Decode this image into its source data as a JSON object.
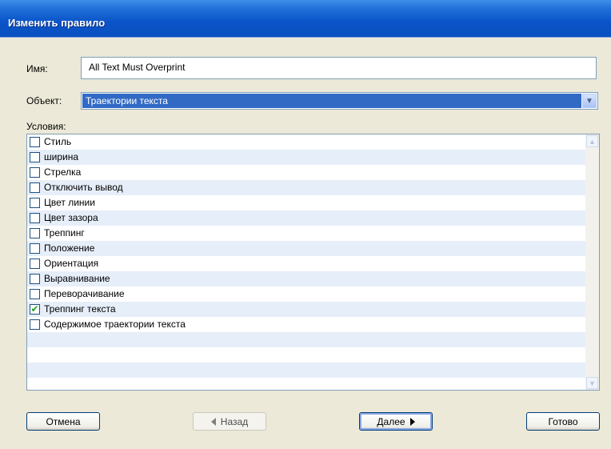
{
  "window": {
    "title": "Изменить правило"
  },
  "form": {
    "name_label": "Имя:",
    "name_value": "All Text Must Overprint",
    "object_label": "Объект:",
    "object_value": "Траектории текста",
    "conditions_label": "Условия:"
  },
  "conditions": [
    {
      "label": "Стиль",
      "checked": false
    },
    {
      "label": "ширина",
      "checked": false
    },
    {
      "label": "Стрелка",
      "checked": false
    },
    {
      "label": "Отключить вывод",
      "checked": false
    },
    {
      "label": "Цвет линии",
      "checked": false
    },
    {
      "label": "Цвет зазора",
      "checked": false
    },
    {
      "label": "Треппинг",
      "checked": false
    },
    {
      "label": "Положение",
      "checked": false
    },
    {
      "label": "Ориентация",
      "checked": false
    },
    {
      "label": "Выравнивание",
      "checked": false
    },
    {
      "label": "Переворачивание",
      "checked": false
    },
    {
      "label": "Треппинг текста",
      "checked": true
    },
    {
      "label": "Содержимое траектории текста",
      "checked": false
    }
  ],
  "buttons": {
    "cancel": "Отмена",
    "back": "Назад",
    "next": "Далее",
    "finish": "Готово"
  }
}
